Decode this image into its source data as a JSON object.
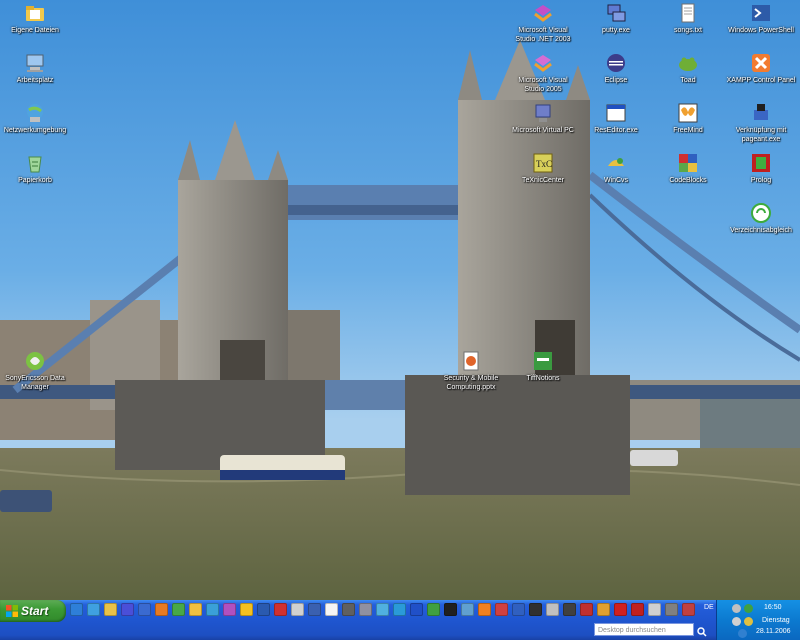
{
  "desktop": {
    "icons": [
      {
        "label": "Eigene Dateien",
        "icon": "folder-documents-icon",
        "color": "#f2c94c"
      },
      {
        "label": "Arbeitsplatz",
        "icon": "computer-icon",
        "color": "#9ec7f0"
      },
      {
        "label": "Netzwerkumgebung",
        "icon": "network-icon",
        "color": "#4fa3e0"
      },
      {
        "label": "Papierkorb",
        "icon": "recycle-bin-icon",
        "color": "#9fd69a"
      },
      {
        "label": "Microsoft Visual Studio .NET 2003",
        "icon": "visual-studio-icon",
        "color": "#c34fc7"
      },
      {
        "label": "Microsoft Visual Studio 2005",
        "icon": "visual-studio-icon",
        "color": "#d66dd3"
      },
      {
        "label": "Microsoft Virtual PC",
        "icon": "virtual-pc-icon",
        "color": "#6f7ec9"
      },
      {
        "label": "TeXnicCenter",
        "icon": "texniccenter-icon",
        "color": "#d8d05a"
      },
      {
        "label": "putty.exe",
        "icon": "putty-icon",
        "color": "#5f7bd3"
      },
      {
        "label": "Eclipse",
        "icon": "eclipse-icon",
        "color": "#3c3c8a"
      },
      {
        "label": "ResEditor.exe",
        "icon": "window-app-icon",
        "color": "#ffffff"
      },
      {
        "label": "WinCvs",
        "icon": "wincvs-icon",
        "color": "#e8c040"
      },
      {
        "label": "songs.txt",
        "icon": "text-file-icon",
        "color": "#ffffff"
      },
      {
        "label": "Toad",
        "icon": "toad-icon",
        "color": "#6fae36"
      },
      {
        "label": "FreeMind",
        "icon": "freemind-icon",
        "color": "#f0a030"
      },
      {
        "label": "CodeBlocks",
        "icon": "codeblocks-icon",
        "color": "#5aa84a"
      },
      {
        "label": "Windows PowerShell",
        "icon": "powershell-icon",
        "color": "#2d5ba8"
      },
      {
        "label": "XAMPP Control Panel",
        "icon": "xampp-icon",
        "color": "#f27b30"
      },
      {
        "label": "Verknüpfung mit pageant.exe",
        "icon": "pageant-icon",
        "color": "#3a66c4"
      },
      {
        "label": "Prolog",
        "icon": "prolog-icon",
        "color": "#c02020"
      },
      {
        "label": "Verzeichnisabgleich",
        "icon": "sync-icon",
        "color": "#3dab3d"
      },
      {
        "label": "SonyEricsson Data Manager",
        "icon": "sonyericsson-icon",
        "color": "#7cc242"
      },
      {
        "label": "Security & Mobile Computing.pptx",
        "icon": "powerpoint-file-icon",
        "color": "#e0642a"
      },
      {
        "label": "TiffNotions",
        "icon": "tiffnotions-icon",
        "color": "#3a9a40"
      }
    ]
  },
  "taskbar": {
    "start_label": "Start",
    "quicklaunch_icons": [
      "ie-icon",
      "globe-icon",
      "mail-icon",
      "save-icon",
      "show-desktop-icon",
      "firefox-icon",
      "chat-icon",
      "explorer-icon",
      "world-icon",
      "vs-icon",
      "sun-icon",
      "media-icon",
      "red-app-icon",
      "text-app-icon",
      "window-icon",
      "notepad-icon",
      "pen-icon",
      "calc-icon",
      "chat2-icon",
      "skype-icon",
      "bluetooth-icon",
      "green-app-icon",
      "terminal-icon",
      "image-icon",
      "vlc-icon",
      "music-icon",
      "wizard-icon",
      "console-icon",
      "chart-icon",
      "film-icon",
      "power-icon",
      "flower-icon",
      "red-circle-icon",
      "pdf-icon",
      "cd-icon",
      "tools-icon",
      "hat-icon"
    ],
    "quicklaunch_colors": [
      "#2e7fd8",
      "#3fa0e0",
      "#e8c24a",
      "#4a4fd8",
      "#3a6ad0",
      "#e77a22",
      "#48a848",
      "#f0c040",
      "#3aa0d8",
      "#b050c0",
      "#f4c020",
      "#2a5ab0",
      "#d03030",
      "#d0d0d0",
      "#3a60b0",
      "#f5f5f5",
      "#606060",
      "#9090a0",
      "#50b0e0",
      "#2a9ad8",
      "#2050c8",
      "#40a040",
      "#202020",
      "#60a0d0",
      "#f08020",
      "#d04040",
      "#3060c0",
      "#303030",
      "#c0c0c0",
      "#404040",
      "#c03030",
      "#e0a030",
      "#d02020",
      "#c02020",
      "#d0d0d0",
      "#808080",
      "#c04040"
    ],
    "language": "DE",
    "search_placeholder": "Desktop durchsuchen",
    "clock": {
      "time": "16:50",
      "day": "Dienstag",
      "date": "28.11.2006"
    }
  },
  "colors": {
    "taskbar": "#245edb",
    "start_button": "#3c9a35",
    "tray": "#0c7ad0"
  }
}
